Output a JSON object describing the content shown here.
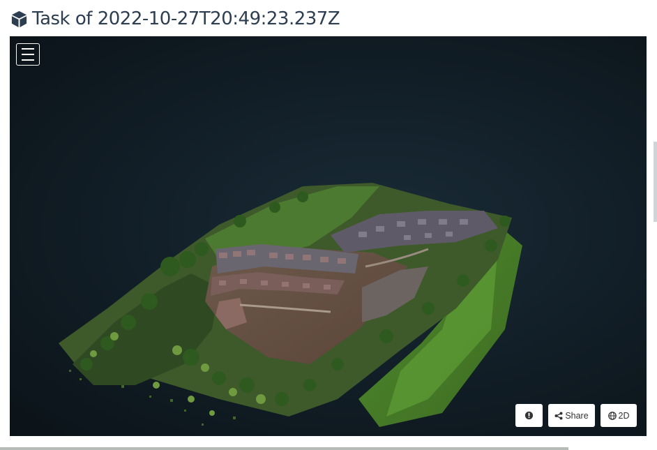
{
  "header": {
    "title": "Task of 2022-10-27T20:49:23.237Z",
    "icon": "cube-icon"
  },
  "viewer": {
    "menu_icon": "hamburger-menu-icon",
    "content": "3D point cloud model"
  },
  "toolbar": {
    "info_icon": "info-circle-icon",
    "share_icon": "share-icon",
    "share_label": "Share",
    "view_icon": "globe-icon",
    "view_label": "2D"
  },
  "colors": {
    "title": "#2c3e50",
    "viewer_bg": "#14222c",
    "button_bg": "#ffffff"
  }
}
